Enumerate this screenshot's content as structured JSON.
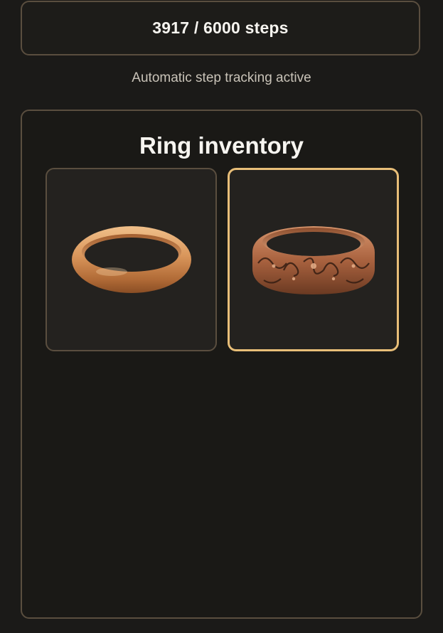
{
  "steps": {
    "display": "3917 / 6000 steps",
    "current": 3917,
    "goal": 6000
  },
  "tracking": {
    "status": "Automatic step tracking active"
  },
  "inventory": {
    "title": "Ring inventory",
    "rings": [
      {
        "name": "plain-gold-ring",
        "icon": "plain-gold-band-icon",
        "selected": false
      },
      {
        "name": "engraved-copper-ring",
        "icon": "engraved-copper-band-icon",
        "selected": true
      }
    ]
  },
  "colors": {
    "background": "#1b1a18",
    "border": "#5a4e3f",
    "selected_border": "#e8be78",
    "gold": "#d9955a",
    "copper": "#b8704a"
  }
}
